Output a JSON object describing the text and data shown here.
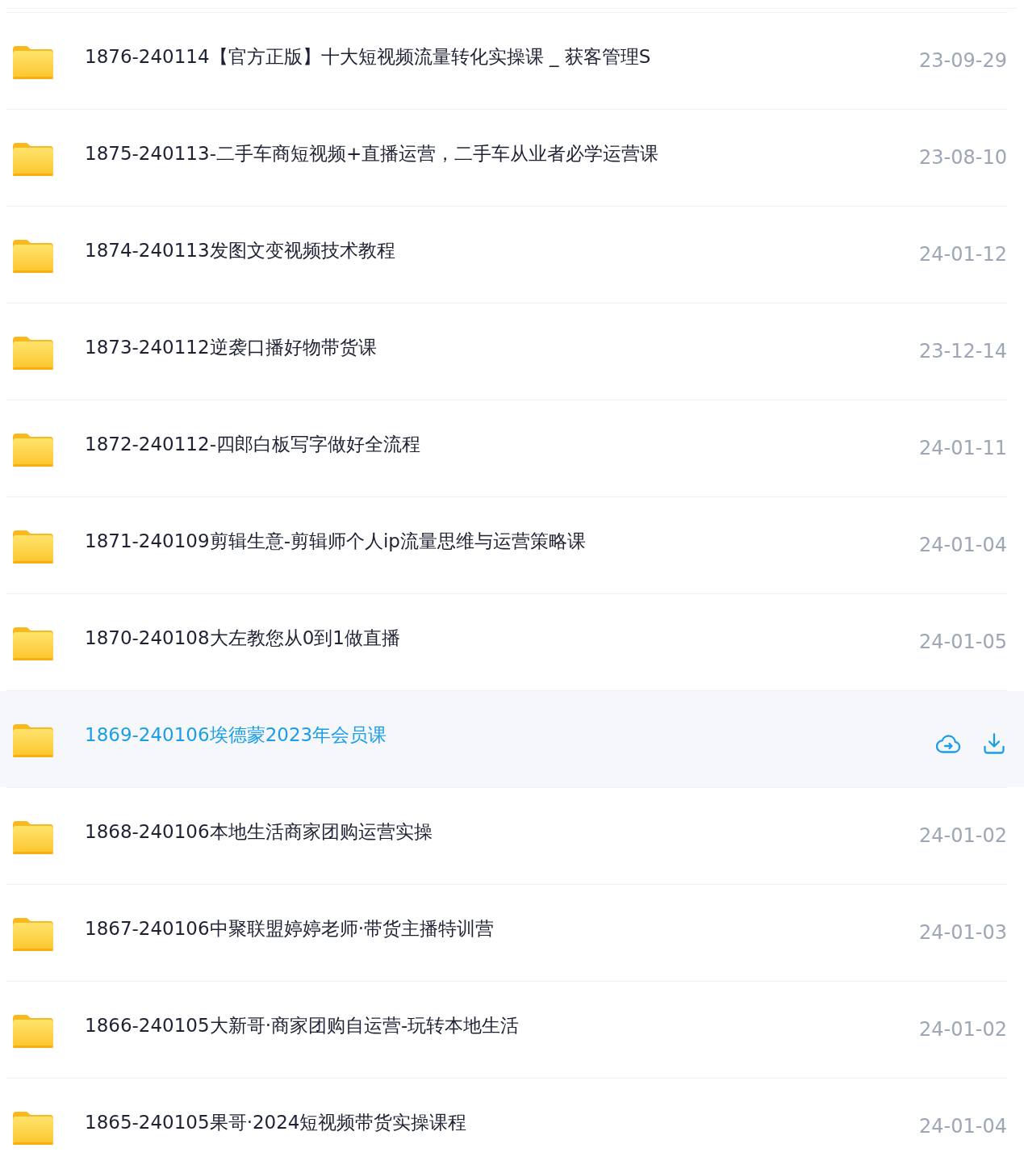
{
  "rows": [
    {
      "name": "1876-240114【官方正版】十大短视频流量转化实操课 _ 获客管理S",
      "date": "23-09-29",
      "selected": false
    },
    {
      "name": "1875-240113-二手车商短视频+直播运营，二手车从业者必学运营课",
      "date": "23-08-10",
      "selected": false
    },
    {
      "name": "1874-240113发图文变视频技术教程",
      "date": "24-01-12",
      "selected": false
    },
    {
      "name": "1873-240112逆袭口播好物带货课",
      "date": "23-12-14",
      "selected": false
    },
    {
      "name": "1872-240112-四郎白板写字做好全流程",
      "date": "24-01-11",
      "selected": false
    },
    {
      "name": "1871-240109剪辑生意-剪辑师个人ip流量思维与运营策略课",
      "date": "24-01-04",
      "selected": false
    },
    {
      "name": "1870-240108大左教您从0到1做直播",
      "date": "24-01-05",
      "selected": false
    },
    {
      "name": "1869-240106埃德蒙2023年会员课",
      "selected": true
    },
    {
      "name": "1868-240106本地生活商家团购运营实操",
      "date": "24-01-02",
      "selected": false
    },
    {
      "name": "1867-240106中聚联盟婷婷老师·带货主播特训营",
      "date": "24-01-03",
      "selected": false
    },
    {
      "name": "1866-240105大新哥·商家团购自运营-玩转本地生活",
      "date": "24-01-02",
      "selected": false
    },
    {
      "name": "1865-240105果哥·2024短视频带货实操课程",
      "date": "24-01-04",
      "selected": false
    }
  ]
}
